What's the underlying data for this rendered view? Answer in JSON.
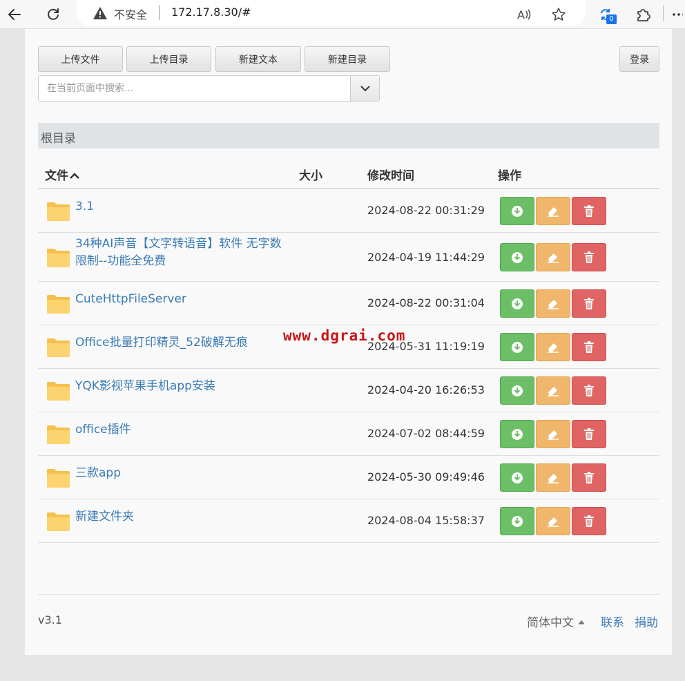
{
  "browser": {
    "security_text": "不安全",
    "url": "172.17.8.30/#",
    "badge_count": "0"
  },
  "toolbar": {
    "upload_file": "上传文件",
    "upload_dir": "上传目录",
    "new_text": "新建文本",
    "new_dir": "新建目录",
    "login": "登录"
  },
  "search": {
    "placeholder": "在当前页面中搜索..."
  },
  "breadcrumb": "根目录",
  "table": {
    "col_name": "文件",
    "col_size": "大小",
    "col_mtime": "修改时间",
    "col_ops": "操作"
  },
  "rows": [
    {
      "name": "3.1",
      "mtime": "2024-08-22 00:31:29"
    },
    {
      "name": "34种AI声音【文字转语音】软件 无字数限制--功能全免费",
      "name_l1": "34种AI声音【文字转语音】软件 无字数",
      "name_l2": "限制--功能全免费",
      "mtime": "2024-04-19 11:44:29"
    },
    {
      "name": "CuteHttpFileServer",
      "mtime": "2024-08-22 00:31:04"
    },
    {
      "name": "Office批量打印精灵_52破解无痕",
      "mtime": "2024-05-31 11:19:19"
    },
    {
      "name": "YQK影视苹果手机app安装",
      "mtime": "2024-04-20 16:26:53"
    },
    {
      "name": "office插件",
      "mtime": "2024-07-02 08:44:59"
    },
    {
      "name": "三款app",
      "mtime": "2024-05-30 09:49:46"
    },
    {
      "name": "新建文件夹",
      "mtime": "2024-08-04 15:58:37"
    }
  ],
  "footer": {
    "version": "v3.1",
    "language": "简体中文",
    "contact": "联系",
    "donate": "捐助"
  },
  "watermark": "www.dgrai.com",
  "colors": {
    "link": "#3a7bb5",
    "download": "#6cbf67",
    "edit": "#f0b76c",
    "delete": "#e06463",
    "folder": "#fcd067"
  }
}
